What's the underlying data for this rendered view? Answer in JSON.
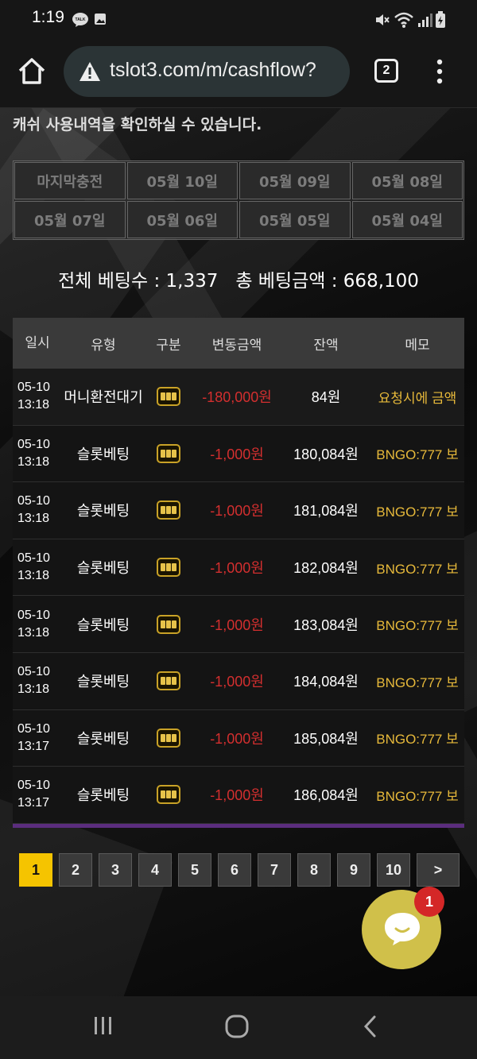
{
  "status_bar": {
    "time": "1:19",
    "icons": [
      "kakaotalk-icon",
      "image-icon",
      "mute-icon",
      "wifi-icon",
      "signal-icon",
      "battery-icon"
    ],
    "talk_label": "TALK"
  },
  "browser": {
    "url": "tslot3.com/m/cashflow?",
    "tab_count": "2",
    "icons": [
      "home-icon",
      "warning-icon",
      "more-vert-icon"
    ]
  },
  "page": {
    "notice": "캐쉬 사용내역을 확인하실 수 있습니다.",
    "date_tabs": [
      "마지막충전",
      "05월 10일",
      "05월 09일",
      "05월 08일",
      "05월 07일",
      "05월 06일",
      "05월 05일",
      "05월 04일"
    ],
    "summary": "전체 베팅수 : 1,337   총 베팅금액 : 668,100",
    "table": {
      "headers": {
        "date": "일시",
        "type": "유형",
        "category": "구분",
        "amount": "변동금액",
        "balance": "잔액",
        "memo": "메모"
      },
      "rows": [
        {
          "date": "05-10",
          "time": "13:18",
          "type": "머니환전대기",
          "category_icon": "slot-machine-icon",
          "amount": "-180,000원",
          "balance": "84원",
          "memo": "요청시에 금액"
        },
        {
          "date": "05-10",
          "time": "13:18",
          "type": "슬롯베팅",
          "category_icon": "slot-machine-icon",
          "amount": "-1,000원",
          "balance": "180,084원",
          "memo": "BNGO:777 보"
        },
        {
          "date": "05-10",
          "time": "13:18",
          "type": "슬롯베팅",
          "category_icon": "slot-machine-icon",
          "amount": "-1,000원",
          "balance": "181,084원",
          "memo": "BNGO:777 보"
        },
        {
          "date": "05-10",
          "time": "13:18",
          "type": "슬롯베팅",
          "category_icon": "slot-machine-icon",
          "amount": "-1,000원",
          "balance": "182,084원",
          "memo": "BNGO:777 보"
        },
        {
          "date": "05-10",
          "time": "13:18",
          "type": "슬롯베팅",
          "category_icon": "slot-machine-icon",
          "amount": "-1,000원",
          "balance": "183,084원",
          "memo": "BNGO:777 보"
        },
        {
          "date": "05-10",
          "time": "13:18",
          "type": "슬롯베팅",
          "category_icon": "slot-machine-icon",
          "amount": "-1,000원",
          "balance": "184,084원",
          "memo": "BNGO:777 보"
        },
        {
          "date": "05-10",
          "time": "13:17",
          "type": "슬롯베팅",
          "category_icon": "slot-machine-icon",
          "amount": "-1,000원",
          "balance": "185,084원",
          "memo": "BNGO:777 보"
        },
        {
          "date": "05-10",
          "time": "13:17",
          "type": "슬롯베팅",
          "category_icon": "slot-machine-icon",
          "amount": "-1,000원",
          "balance": "186,084원",
          "memo": "BNGO:777 보"
        }
      ]
    },
    "pagination": {
      "pages": [
        "1",
        "2",
        "3",
        "4",
        "5",
        "6",
        "7",
        "8",
        "9",
        "10"
      ],
      "active": "1",
      "next": ">"
    },
    "chat": {
      "badge": "1",
      "icon": "chat-bubble-icon"
    }
  },
  "nav_bar": {
    "icons": [
      "recent-apps-icon",
      "home-circle-icon",
      "back-icon"
    ]
  },
  "colors": {
    "accent": "#f5c400",
    "negative": "#d32f2f",
    "memo": "#e7b93a",
    "chat": "#d0c04a",
    "badge": "#d42727"
  }
}
